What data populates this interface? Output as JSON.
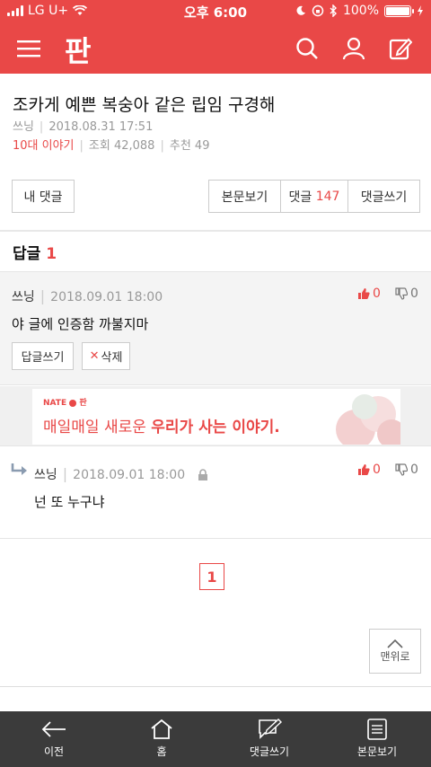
{
  "status_bar": {
    "carrier": "LG U+",
    "time": "오후 6:00",
    "battery": "100%",
    "battery_level": 1.0
  },
  "header": {
    "logo": "판",
    "icons": [
      "menu-icon",
      "search-icon",
      "user-icon",
      "edit-icon"
    ],
    "bg_color": "#e94847"
  },
  "post": {
    "title": "조카게 예쁜 복숭아 같은 립임 구경해",
    "author": "쓰닝",
    "date": "2018.08.31 17:51",
    "category": "10대 이야기",
    "views_label": "조회",
    "views": "42,088",
    "recommend_label": "추천",
    "recommend": "49"
  },
  "actions": {
    "my_comments": "내 댓글",
    "view_body": "본문보기",
    "comments_label": "댓글",
    "comments_count": "147",
    "write_comment": "댓글쓰기"
  },
  "replies": {
    "heading": "답글",
    "count": "1"
  },
  "comment": {
    "author": "쓰닝",
    "date": "2018.09.01 18:00",
    "body": "야 글에 인증함 까불지마",
    "up": "0",
    "down": "0",
    "reply_btn": "답글쓰기",
    "delete_btn": "삭제"
  },
  "ad": {
    "brand": "NATE",
    "brand2": "판",
    "text_a": "매일매일 새로운",
    "text_b": "우리가 사는 이야기."
  },
  "reply": {
    "author": "쓰닝",
    "date": "2018.09.01 18:00",
    "body": "넌 또 누구냐",
    "up": "0",
    "down": "0"
  },
  "pagination": {
    "current": "1"
  },
  "to_top": "맨위로",
  "bottom_nav": {
    "back": "이전",
    "home": "홈",
    "write": "댓글쓰기",
    "view": "본문보기"
  },
  "colors": {
    "accent": "#e94847",
    "bottom_bar": "#3b3b3b"
  }
}
